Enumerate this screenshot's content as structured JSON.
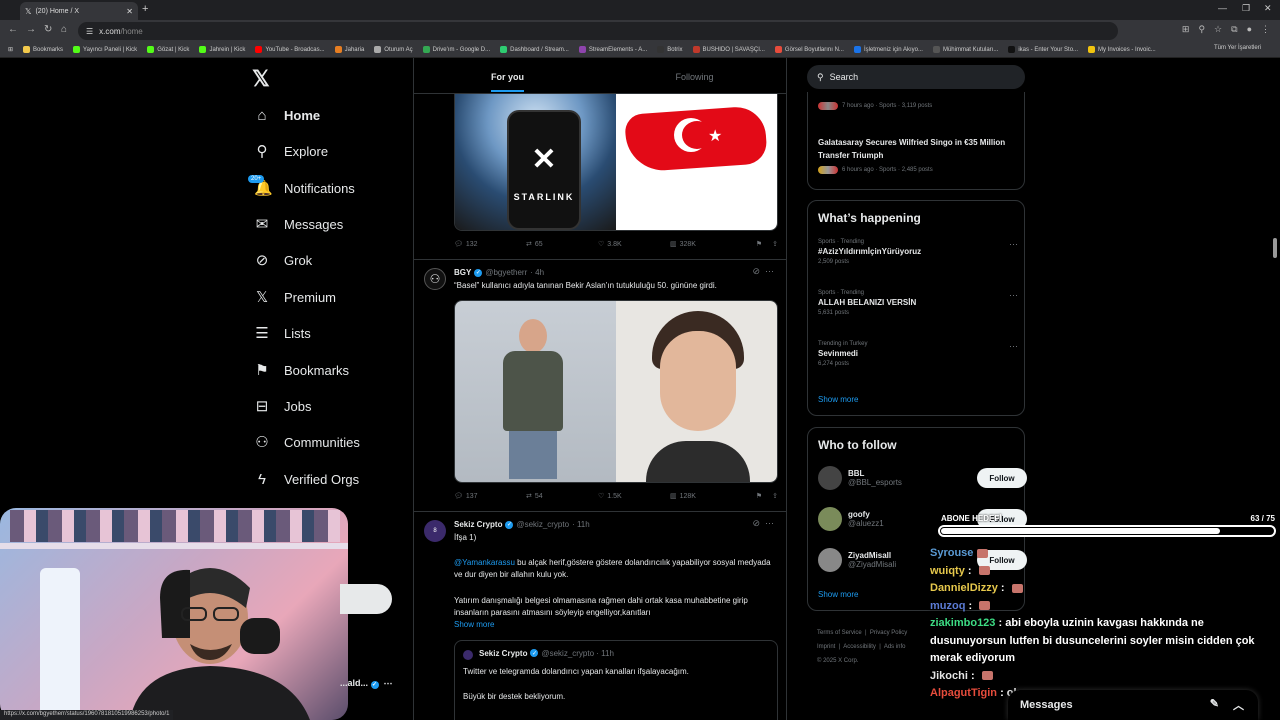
{
  "browser": {
    "tab_title": "(20) Home / X",
    "new_tab": "+",
    "url_host": "x.com",
    "url_path": "/home",
    "status_url": "https://x.com/bgyetherr/status/1960781810519986253/photo/1",
    "bookmarks": [
      {
        "label": "Bookmarks",
        "color": "#f2c94c"
      },
      {
        "label": "Yayıncı Paneli | Kick",
        "color": "#53fc18"
      },
      {
        "label": "Gözat | Kick",
        "color": "#53fc18"
      },
      {
        "label": "Jahrein | Kick",
        "color": "#53fc18"
      },
      {
        "label": "YouTube - Broadcas...",
        "color": "#ff0000"
      },
      {
        "label": "Jaharia",
        "color": "#e67e22"
      },
      {
        "label": "Oturum Aç",
        "color": "#aaaaaa"
      },
      {
        "label": "Drive'ım - Google D...",
        "color": "#34a853"
      },
      {
        "label": "Dashboard / Stream...",
        "color": "#2ecc71"
      },
      {
        "label": "StreamElements - A...",
        "color": "#8e44ad"
      },
      {
        "label": "Botrix",
        "color": "#333333"
      },
      {
        "label": "BUSHIDO | SAVAŞÇI...",
        "color": "#c0392b"
      },
      {
        "label": "Görsel Boyutlarını N...",
        "color": "#e74c3c"
      },
      {
        "label": "İşletmeniz için Akıyo...",
        "color": "#1a73e8"
      },
      {
        "label": "Mühimmat Kutuları...",
        "color": "#555555"
      },
      {
        "label": "ikas - Enter Your Sto...",
        "color": "#111111"
      },
      {
        "label": "My Invoices - Invoic...",
        "color": "#f1c40f"
      }
    ],
    "all_bookmarks": "Tüm Yer İşaretleri"
  },
  "nav": {
    "items": [
      {
        "label": "Home",
        "icon": "home-icon",
        "glyph": "⌂"
      },
      {
        "label": "Explore",
        "icon": "search-icon",
        "glyph": "⚲"
      },
      {
        "label": "Notifications",
        "icon": "bell-icon",
        "glyph": "🔔",
        "badge": "20+"
      },
      {
        "label": "Messages",
        "icon": "envelope-icon",
        "glyph": "✉"
      },
      {
        "label": "Grok",
        "icon": "grok-icon",
        "glyph": "⊘"
      },
      {
        "label": "Premium",
        "icon": "x-logo-icon",
        "glyph": "𝕏"
      },
      {
        "label": "Lists",
        "icon": "list-icon",
        "glyph": "☰"
      },
      {
        "label": "Bookmarks",
        "icon": "bookmark-icon",
        "glyph": "⚑"
      },
      {
        "label": "Jobs",
        "icon": "briefcase-icon",
        "glyph": "⊟"
      },
      {
        "label": "Communities",
        "icon": "people-icon",
        "glyph": "⚇"
      },
      {
        "label": "Verified Orgs",
        "icon": "lightning-icon",
        "glyph": "ϟ"
      }
    ],
    "bottom_user": "...ald..."
  },
  "feed": {
    "tabs": [
      "For you",
      "Following"
    ],
    "post1": {
      "replies": "132",
      "reposts": "65",
      "likes": "3.8K",
      "views": "328K",
      "starlink_label": "STARLINK"
    },
    "post2": {
      "name": "BGY",
      "handle": "@bgyetherr",
      "time": "· 4h",
      "text": "“Basel” kullanıcı adıyla tanınan Bekir Aslan’ın tutukluluğu 50. gününe girdi.",
      "replies": "137",
      "reposts": "54",
      "likes": "1.5K",
      "views": "128K"
    },
    "post3": {
      "name": "Sekiz Crypto",
      "handle": "@sekiz_crypto",
      "time": "· 11h",
      "line1": "İfşa 1)",
      "mention": "@Yamankarassu",
      "line2": " bu alçak herif,göstere göstere dolandırıcılık yapabiliyor sosyal medyada ve dur diyen bir allahın kulu yok.",
      "line3": "Yatırım danışmalığı belgesi olmamasına rağmen dahi ortak kasa muhabbetine girip insanların parasını atmasını söyleyip engelliyor,kanıtları",
      "show_more": "Show more",
      "quote_name": "Sekiz Crypto",
      "quote_handle": "@sekiz_crypto · 11h",
      "quote_line1": "Twitter ve telegramda dolandırıcı yapan  kanalları ifşalayacağım.",
      "quote_line2": "Büyük bir destek bekliyorum."
    }
  },
  "sidebar": {
    "search_placeholder": "Search",
    "trend_top": {
      "meta": "7 hours ago · Sports · 3,119 posts"
    },
    "trend_galatasaray": {
      "title": "Galatasaray Secures Wilfried Singo in €35 Million Transfer Triumph",
      "meta": "6 hours ago · Sports · 2,485 posts"
    },
    "whats_happening": "What’s happening",
    "trends": [
      {
        "ctx": "Sports · Trending",
        "title": "#AzizYıldırımİçinYürüyoruz",
        "count": "2,509 posts"
      },
      {
        "ctx": "Sports · Trending",
        "title": "ALLAH BELANIZI VERSİN",
        "count": "5,631 posts"
      },
      {
        "ctx": "Trending in Turkey",
        "title": "Sevinmedi",
        "count": "6,274 posts"
      }
    ],
    "show_more": "Show more",
    "who_to_follow": "Who to follow",
    "follow_label": "Follow",
    "accounts": [
      {
        "name": "BBL",
        "handle": "@BBL_esports",
        "color": "#444"
      },
      {
        "name": "goofy",
        "handle": "@aluezz1",
        "color": "#7a8b5a"
      },
      {
        "name": "ZiyadMisall",
        "handle": "@ZiyadMisali",
        "color": "#888"
      }
    ],
    "footer": {
      "terms": "Terms of Service",
      "privacy": "Privacy Policy",
      "imprint": "Imprint",
      "accessibility": "Accessibility",
      "ads": "Ads info",
      "copyright": "© 2025 X Corp."
    }
  },
  "overlay": {
    "goal_label": "ABONE HEDEFİ",
    "goal_count": "63  / 75",
    "goal_fraction": 0.84,
    "chat": [
      {
        "user": "Syrouse",
        "color": "#5b9bd5",
        "msg": "",
        "emote": true
      },
      {
        "user": "wuiqty",
        "color": "#e6c84c",
        "msg": " : ",
        "emote": true
      },
      {
        "user": "DannielDizzy",
        "color": "#e6c84c",
        "msg": " : ",
        "emote": true
      },
      {
        "user": "muzoq",
        "color": "#5b7bd5",
        "msg": " : ",
        "emote": true
      },
      {
        "user": "ziakimbo123",
        "color": "#3ddc84",
        "msg": " : abi eboyla uzinin kavgası hakkında ne dusunuyorsun lutfen bi dusuncelerini soyler misin cidden çok merak ediyorum",
        "emote": false
      },
      {
        "user": "Jikochi",
        "color": "#e6e6e6",
        "msg": " : ",
        "emote": true
      },
      {
        "user": "AlpagutTigin",
        "color": "#e74c3c",
        "msg": " : oku onu",
        "emote": false
      }
    ],
    "messages_dock": "Messages"
  }
}
